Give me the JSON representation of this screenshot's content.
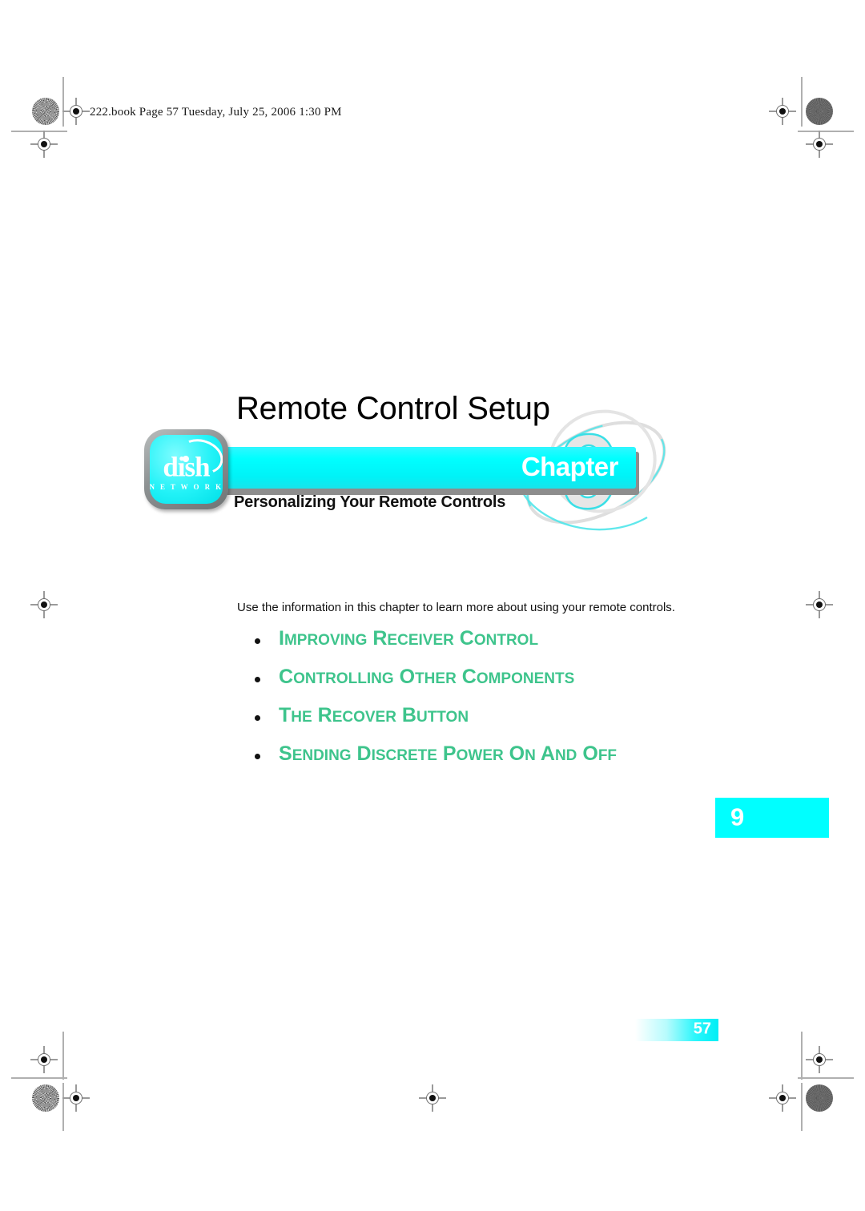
{
  "document": {
    "header_slug": "222.book  Page 57  Tuesday, July 25, 2006  1:30 PM",
    "page_number": "57",
    "chapter_number": "9"
  },
  "chapter": {
    "title": "Remote Control Setup",
    "banner_label": "Chapter",
    "banner_number": "9",
    "subtitle": "Personalizing Your Remote Controls",
    "logo": {
      "wordmark": "dish",
      "tagline": "N E T W O R K"
    }
  },
  "body": {
    "intro": "Use the information in this chapter to learn more about using your remote controls.",
    "toc_items": [
      "IMPROVING RECEIVER CONTROL",
      "CONTROLLING OTHER COMPONENTS",
      "THE RECOVER BUTTON",
      "SENDING DISCRETE POWER ON AND OFF"
    ]
  },
  "colors": {
    "cyan": "#00FFFF",
    "green": "#3EC48C",
    "logo_border": "#8D9192"
  }
}
